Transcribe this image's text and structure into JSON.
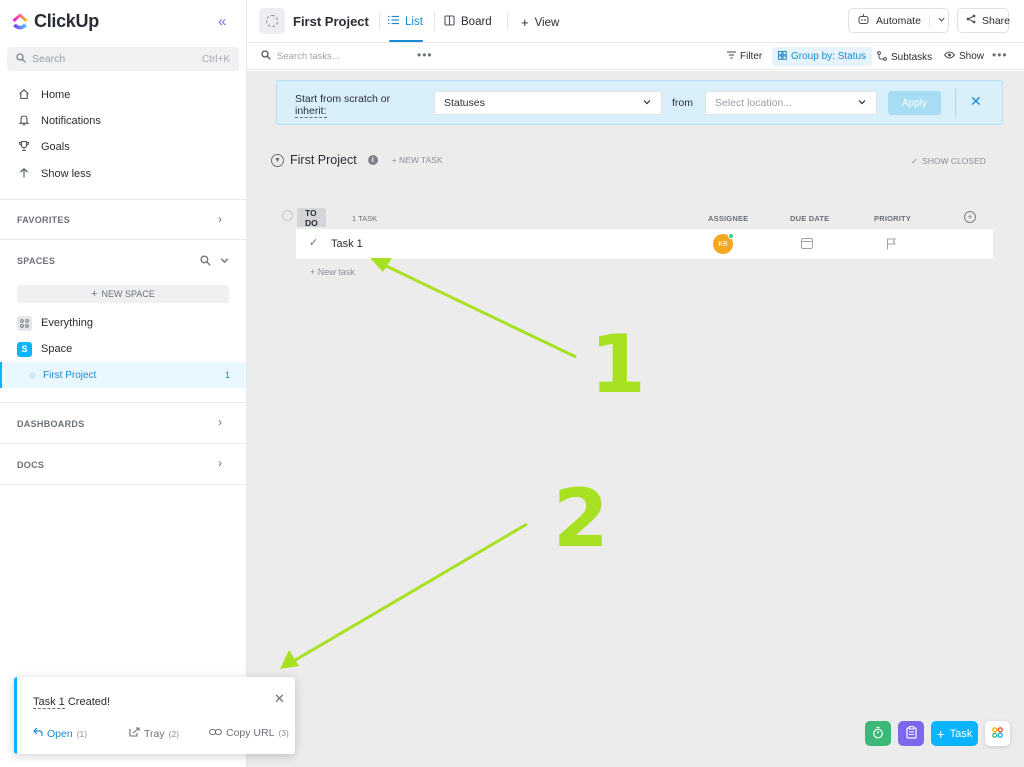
{
  "app": {
    "logo_text": "ClickUp",
    "accent_color": "#0ab4ff",
    "brand_color": "#7b68ee"
  },
  "sidebar": {
    "search_placeholder": "Search",
    "search_shortcut": "Ctrl+K",
    "nav": [
      {
        "icon": "home-icon",
        "label": "Home"
      },
      {
        "icon": "bell-icon",
        "label": "Notifications"
      },
      {
        "icon": "trophy-icon",
        "label": "Goals"
      },
      {
        "icon": "arrow-up-icon",
        "label": "Show less"
      }
    ],
    "favorites_label": "FAVORITES",
    "spaces_label": "SPACES",
    "new_space_label": "NEW SPACE",
    "everything_label": "Everything",
    "space_badge": "S",
    "space_label": "Space",
    "project_label": "First Project",
    "project_count": "1",
    "dashboards_label": "DASHBOARDS",
    "docs_label": "DOCS"
  },
  "header": {
    "project_title": "First Project",
    "tabs": [
      {
        "icon": "list-icon",
        "label": "List",
        "active": true
      },
      {
        "icon": "board-icon",
        "label": "Board",
        "active": false
      },
      {
        "icon": "plus-icon",
        "label": "View",
        "active": false
      }
    ],
    "automate_label": "Automate",
    "share_label": "Share"
  },
  "toolbar": {
    "search_placeholder": "Search tasks...",
    "filter_label": "Filter",
    "group_by_label": "Group by: Status",
    "subtasks_label": "Subtasks",
    "show_label": "Show"
  },
  "banner": {
    "text_line1": "Start from scratch or",
    "text_line2": "inherit:",
    "statuses_value": "Statuses",
    "from_label": "from",
    "location_placeholder": "Select location...",
    "apply_label": "Apply"
  },
  "list": {
    "title": "First Project",
    "info_badge": "i",
    "new_task_label": "+ NEW TASK",
    "show_closed_label": "SHOW CLOSED",
    "status_label": "TO DO",
    "task_count_label": "1 TASK",
    "columns": {
      "assignee": "ASSIGNEE",
      "due_date": "DUE DATE",
      "priority": "PRIORITY"
    },
    "tasks": [
      {
        "name": "Task 1",
        "assignee_initials": "KB",
        "assignee_color": "#f5a623"
      }
    ],
    "new_task_row_label": "+ New task"
  },
  "toast": {
    "title_prefix": "Task 1",
    "title_suffix": " Created!",
    "open_label": "Open",
    "open_key": "(1)",
    "tray_label": "Tray",
    "tray_key": "(2)",
    "copy_label": "Copy URL",
    "copy_key": "(3)"
  },
  "fabs": {
    "task_label": "Task",
    "timer_color": "#3cb878",
    "notepad_color": "#7b68ee",
    "task_color": "#0ab4ff"
  },
  "annotations": {
    "marker_1": "1",
    "marker_2": "2",
    "color": "#a8e022"
  }
}
